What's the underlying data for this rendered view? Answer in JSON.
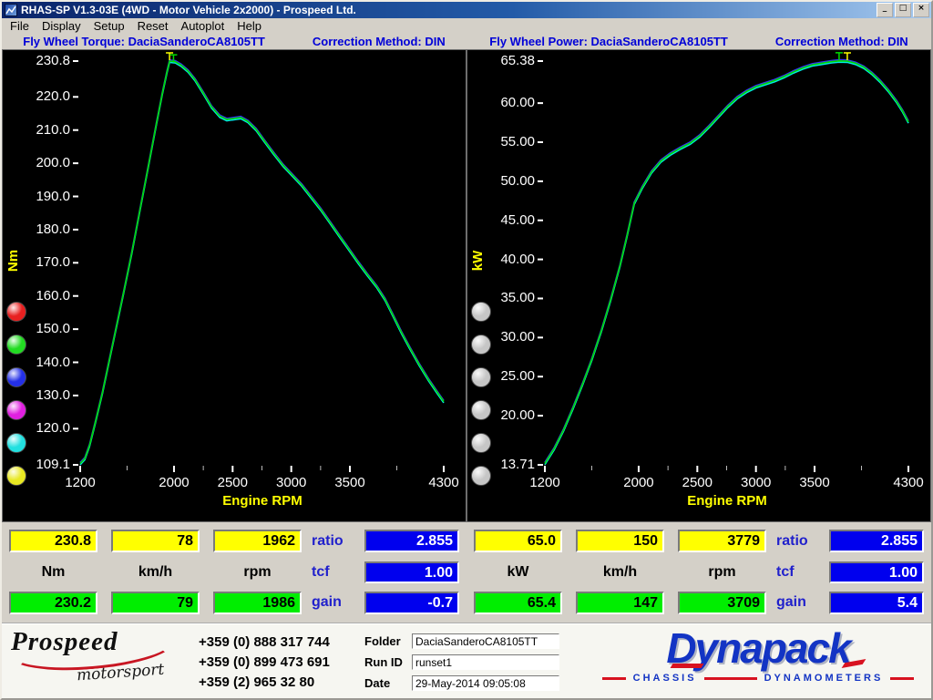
{
  "window": {
    "title": "RHAS-SP V1.3-03E  (4WD - Motor Vehicle 2x2000) - Prospeed Ltd.",
    "controls": {
      "minimize": "_",
      "maximize": "□",
      "close": "×"
    },
    "menu": [
      "File",
      "Display",
      "Setup",
      "Reset",
      "Autoplot",
      "Help"
    ]
  },
  "charts": {
    "torque": {
      "header_title": "Fly Wheel Torque: DaciaSanderoCA8105TT",
      "header_method": "Correction Method: DIN",
      "unit": "Nm",
      "xlabel": "Engine RPM"
    },
    "power": {
      "header_title": "Fly Wheel Power: DaciaSanderoCA8105TT",
      "header_method": "Correction Method: DIN",
      "unit": "kW",
      "xlabel": "Engine RPM"
    }
  },
  "run_buttons": {
    "torque": [
      "#e82020",
      "#22dc22",
      "#2430e8",
      "#e020e0",
      "#22e0e0",
      "#e8e822"
    ],
    "power": [
      "#c6c6c6",
      "#c6c6c6",
      "#c6c6c6",
      "#c6c6c6",
      "#c6c6c6",
      "#c6c6c6"
    ]
  },
  "readouts": {
    "torque": {
      "yellow": [
        "230.8",
        "78",
        "1962"
      ],
      "units": [
        "Nm",
        "km/h",
        "rpm"
      ],
      "green": [
        "230.2",
        "79",
        "1986"
      ],
      "ratio_label": "ratio",
      "tcf_label": "tcf",
      "gain_label": "gain",
      "ratio": "2.855",
      "tcf": "1.00",
      "gain": "-0.7"
    },
    "power": {
      "yellow": [
        "65.0",
        "150",
        "3779"
      ],
      "units": [
        "kW",
        "km/h",
        "rpm"
      ],
      "green": [
        "65.4",
        "147",
        "3709"
      ],
      "ratio_label": "ratio",
      "tcf_label": "tcf",
      "gain_label": "gain",
      "ratio": "2.855",
      "tcf": "1.00",
      "gain": "5.4"
    }
  },
  "footer": {
    "phones": [
      "+359 (0) 888 317 744",
      "+359 (0) 899 473 691",
      "+359 (2) 965 32 80"
    ],
    "fields": {
      "folder_label": "Folder",
      "folder": "DaciaSanderoCA8105TT",
      "runid_label": "Run ID",
      "runid": "runset1",
      "date_label": "Date",
      "date": "29-May-2014  09:05:08"
    },
    "prospeed": {
      "name": "Prospeed",
      "sub": "motorsport"
    },
    "dynapack": {
      "name": "Dynapack",
      "sub_left": "CHASSIS",
      "sub_right": "DYNAMOMETERS"
    }
  },
  "chart_data": [
    {
      "name": "torque",
      "type": "line",
      "title": "Fly Wheel Torque: DaciaSanderoCA8105TT",
      "correction_method": "DIN",
      "xlabel": "Engine RPM",
      "ylabel": "Nm",
      "xlim": [
        1200,
        4300
      ],
      "ylim": [
        109.1,
        230.8
      ],
      "x_ticks": [
        1200,
        2000,
        2500,
        3000,
        3500,
        4300
      ],
      "x_tick_labels": [
        "1200",
        "2000",
        "2500",
        "3000",
        "3500",
        "4300"
      ],
      "y_ticks": [
        230.8,
        220.0,
        210.0,
        200.0,
        190.0,
        180.0,
        170.0,
        160.0,
        150.0,
        140.0,
        130.0,
        120.0,
        109.1
      ],
      "y_tick_labels": [
        "230.8",
        "220.0",
        "210.0",
        "200.0",
        "190.0",
        "180.0",
        "170.0",
        "160.0",
        "150.0",
        "140.0",
        "130.0",
        "120.0",
        "109.1"
      ],
      "runs": [
        {
          "name": "run-blue",
          "color": "#3434f0",
          "offset": -1.2
        },
        {
          "name": "run-cyan",
          "color": "#00e8e8",
          "offset": 1.4
        },
        {
          "name": "run-green",
          "color": "#00d800",
          "offset": 0
        }
      ],
      "points": [
        [
          1200,
          109.5
        ],
        [
          1240,
          111
        ],
        [
          1280,
          115
        ],
        [
          1330,
          122
        ],
        [
          1390,
          131
        ],
        [
          1450,
          141
        ],
        [
          1510,
          151
        ],
        [
          1570,
          161
        ],
        [
          1640,
          173
        ],
        [
          1710,
          186
        ],
        [
          1780,
          199
        ],
        [
          1850,
          212
        ],
        [
          1900,
          221
        ],
        [
          1940,
          227.5
        ],
        [
          1962,
          230.8
        ],
        [
          2010,
          230.6
        ],
        [
          2060,
          229.6
        ],
        [
          2120,
          227.8
        ],
        [
          2180,
          225.2
        ],
        [
          2250,
          221.2
        ],
        [
          2320,
          217
        ],
        [
          2390,
          214.2
        ],
        [
          2450,
          213.2
        ],
        [
          2510,
          213.5
        ],
        [
          2570,
          213.8
        ],
        [
          2630,
          212.6
        ],
        [
          2700,
          210.2
        ],
        [
          2770,
          206.8
        ],
        [
          2850,
          203
        ],
        [
          2930,
          199.4
        ],
        [
          3010,
          196.4
        ],
        [
          3090,
          193.4
        ],
        [
          3170,
          189.8
        ],
        [
          3250,
          186.2
        ],
        [
          3330,
          182.2
        ],
        [
          3410,
          178.2
        ],
        [
          3490,
          174.2
        ],
        [
          3570,
          170.2
        ],
        [
          3650,
          166.4
        ],
        [
          3730,
          162.8
        ],
        [
          3800,
          159
        ],
        [
          3870,
          154
        ],
        [
          3940,
          149
        ],
        [
          4010,
          144.4
        ],
        [
          4090,
          139.4
        ],
        [
          4170,
          134.8
        ],
        [
          4240,
          131.2
        ],
        [
          4300,
          128.2
        ]
      ],
      "peak_markers": [
        {
          "x": 1962,
          "y": 230.8,
          "color": "#ffff00"
        },
        {
          "x": 1996,
          "y": 230.2,
          "color": "#00dd00"
        }
      ]
    },
    {
      "name": "power",
      "type": "line",
      "title": "Fly Wheel Power: DaciaSanderoCA8105TT",
      "correction_method": "DIN",
      "xlabel": "Engine RPM",
      "ylabel": "kW",
      "xlim": [
        1200,
        4300
      ],
      "ylim": [
        13.71,
        65.38
      ],
      "x_ticks": [
        1200,
        2000,
        2500,
        3000,
        3500,
        4300
      ],
      "x_tick_labels": [
        "1200",
        "2000",
        "2500",
        "3000",
        "3500",
        "4300"
      ],
      "y_ticks": [
        65.38,
        60.0,
        55.0,
        50.0,
        45.0,
        40.0,
        35.0,
        30.0,
        25.0,
        20.0,
        13.71
      ],
      "y_tick_labels": [
        "65.38",
        "60.00",
        "55.00",
        "50.00",
        "45.00",
        "40.00",
        "35.00",
        "30.00",
        "25.00",
        "20.00",
        "13.71"
      ],
      "runs": [
        {
          "name": "run-blue",
          "color": "#3434f0",
          "offset": -1.2
        },
        {
          "name": "run-cyan",
          "color": "#00e8e8",
          "offset": 1.4
        },
        {
          "name": "run-green",
          "color": "#00d800",
          "offset": 0
        }
      ],
      "points": [
        [
          1200,
          13.9
        ],
        [
          1280,
          15.8
        ],
        [
          1360,
          18.2
        ],
        [
          1440,
          21
        ],
        [
          1520,
          24
        ],
        [
          1600,
          27.2
        ],
        [
          1680,
          30.8
        ],
        [
          1760,
          34.8
        ],
        [
          1840,
          39.2
        ],
        [
          1900,
          43
        ],
        [
          1962,
          47.2
        ],
        [
          2030,
          49.2
        ],
        [
          2110,
          51.2
        ],
        [
          2190,
          52.6
        ],
        [
          2270,
          53.5
        ],
        [
          2350,
          54.2
        ],
        [
          2440,
          54.9
        ],
        [
          2520,
          55.8
        ],
        [
          2600,
          57
        ],
        [
          2680,
          58.3
        ],
        [
          2760,
          59.6
        ],
        [
          2840,
          60.7
        ],
        [
          2920,
          61.5
        ],
        [
          3000,
          62.1
        ],
        [
          3080,
          62.5
        ],
        [
          3160,
          62.9
        ],
        [
          3240,
          63.4
        ],
        [
          3320,
          64
        ],
        [
          3400,
          64.5
        ],
        [
          3480,
          64.9
        ],
        [
          3560,
          65.1
        ],
        [
          3640,
          65.3
        ],
        [
          3709,
          65.4
        ],
        [
          3779,
          65.38
        ],
        [
          3850,
          65.1
        ],
        [
          3920,
          64.6
        ],
        [
          3990,
          63.8
        ],
        [
          4060,
          62.8
        ],
        [
          4130,
          61.6
        ],
        [
          4200,
          60.2
        ],
        [
          4250,
          59
        ],
        [
          4300,
          57.6
        ]
      ],
      "peak_markers": [
        {
          "x": 3779,
          "y": 65.38,
          "color": "#ffff00"
        },
        {
          "x": 3709,
          "y": 65.4,
          "color": "#00dd00"
        }
      ]
    }
  ]
}
